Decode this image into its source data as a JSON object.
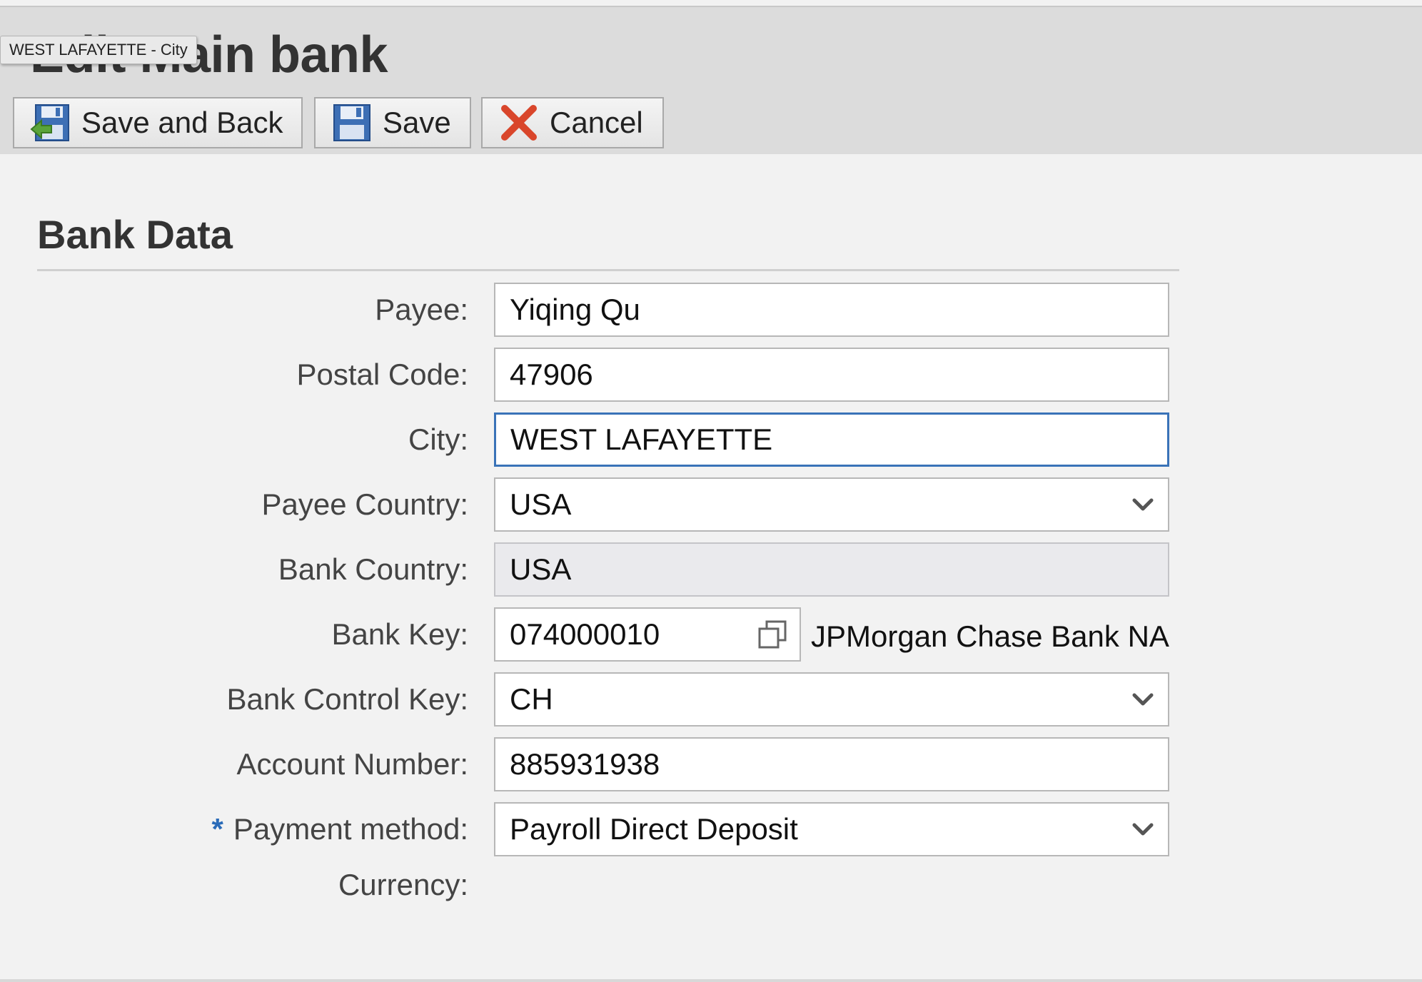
{
  "page": {
    "title": "Edit Main bank",
    "tooltip": "WEST LAFAYETTE - City"
  },
  "toolbar": {
    "save_and_back_label": "Save and Back",
    "save_label": "Save",
    "cancel_label": "Cancel",
    "save_and_back_icon": "save-and-back-icon",
    "save_icon": "floppy-disk-icon",
    "cancel_icon": "red-x-icon"
  },
  "section": {
    "title": "Bank Data"
  },
  "form": {
    "payee": {
      "label": "Payee:",
      "value": "Yiqing Qu"
    },
    "postal_code": {
      "label": "Postal Code:",
      "value": "47906"
    },
    "city": {
      "label": "City:",
      "value": "WEST LAFAYETTE"
    },
    "payee_country": {
      "label": "Payee Country:",
      "value": "USA"
    },
    "bank_country": {
      "label": "Bank Country:",
      "value": "USA"
    },
    "bank_key": {
      "label": "Bank Key:",
      "value": "074000010",
      "bank_name": "JPMorgan Chase Bank NA"
    },
    "bank_control_key": {
      "label": "Bank Control Key:",
      "value": "CH"
    },
    "account_number": {
      "label": "Account Number:",
      "value": "885931938"
    },
    "payment_method": {
      "required_marker": "*",
      "label": "Payment method:",
      "value": "Payroll Direct Deposit"
    },
    "currency": {
      "label": "Currency:"
    }
  },
  "colors": {
    "background": "#f2f2f2",
    "header": "#dcdcdc",
    "focus_border": "#3a73b8",
    "required": "#2a6bb8",
    "cancel_red": "#d9462b"
  }
}
